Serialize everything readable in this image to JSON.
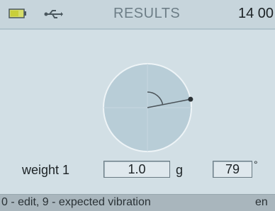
{
  "header": {
    "battery_icon": "battery-icon",
    "usb_icon": "usb-icon",
    "title": "RESULTS",
    "time": "14 00"
  },
  "polar_plot": {
    "angle_degrees": 79,
    "marker_icon": "dot",
    "arc_icon": "arc",
    "colors": {
      "circle_fill": "#b8cdd7",
      "circle_stroke": "#eef4f7",
      "line": "#4a5258"
    }
  },
  "weights": [
    {
      "label": "weight 1",
      "value": "1.0",
      "unit": "g",
      "angle": "79",
      "angle_unit": "°"
    }
  ],
  "footer": {
    "hint": "0 - edit, 9 - expected vibration",
    "language": "en"
  }
}
